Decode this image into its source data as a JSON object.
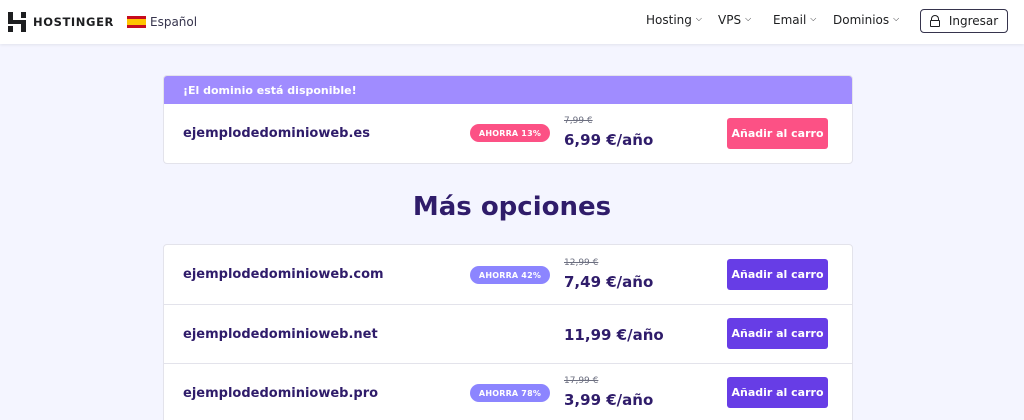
{
  "header": {
    "brand": "HOSTINGER",
    "language": "Español",
    "nav": [
      {
        "label": "Hosting"
      },
      {
        "label": "VPS"
      },
      {
        "label": "Email"
      },
      {
        "label": "Dominios"
      }
    ],
    "login_label": "Ingresar"
  },
  "available": {
    "banner": "¡El dominio está disponible!",
    "domain": "ejemplodedominioweb.es",
    "badge": "AHORRA 13%",
    "old_price": "7,99 €",
    "price": "6,99 €/año",
    "button": "Añadir al carro"
  },
  "more_options": {
    "title": "Más opciones",
    "items": [
      {
        "domain": "ejemplodedominioweb.com",
        "badge": "AHORRA 42%",
        "old_price": "12,99 €",
        "price": "7,49 €/año",
        "button": "Añadir al carro"
      },
      {
        "domain": "ejemplodedominioweb.net",
        "badge": "",
        "old_price": "",
        "price": "11,99 €/año",
        "button": "Añadir al carro"
      },
      {
        "domain": "ejemplodedominioweb.pro",
        "badge": "AHORRA 78%",
        "old_price": "17,99 €",
        "price": "3,99 €/año",
        "button": "Añadir al carro"
      }
    ]
  },
  "colors": {
    "brand_purple": "#673de6",
    "accent_pink": "#fc5185",
    "banner_lavender": "#a08cff",
    "heading": "#2f1c6a"
  }
}
